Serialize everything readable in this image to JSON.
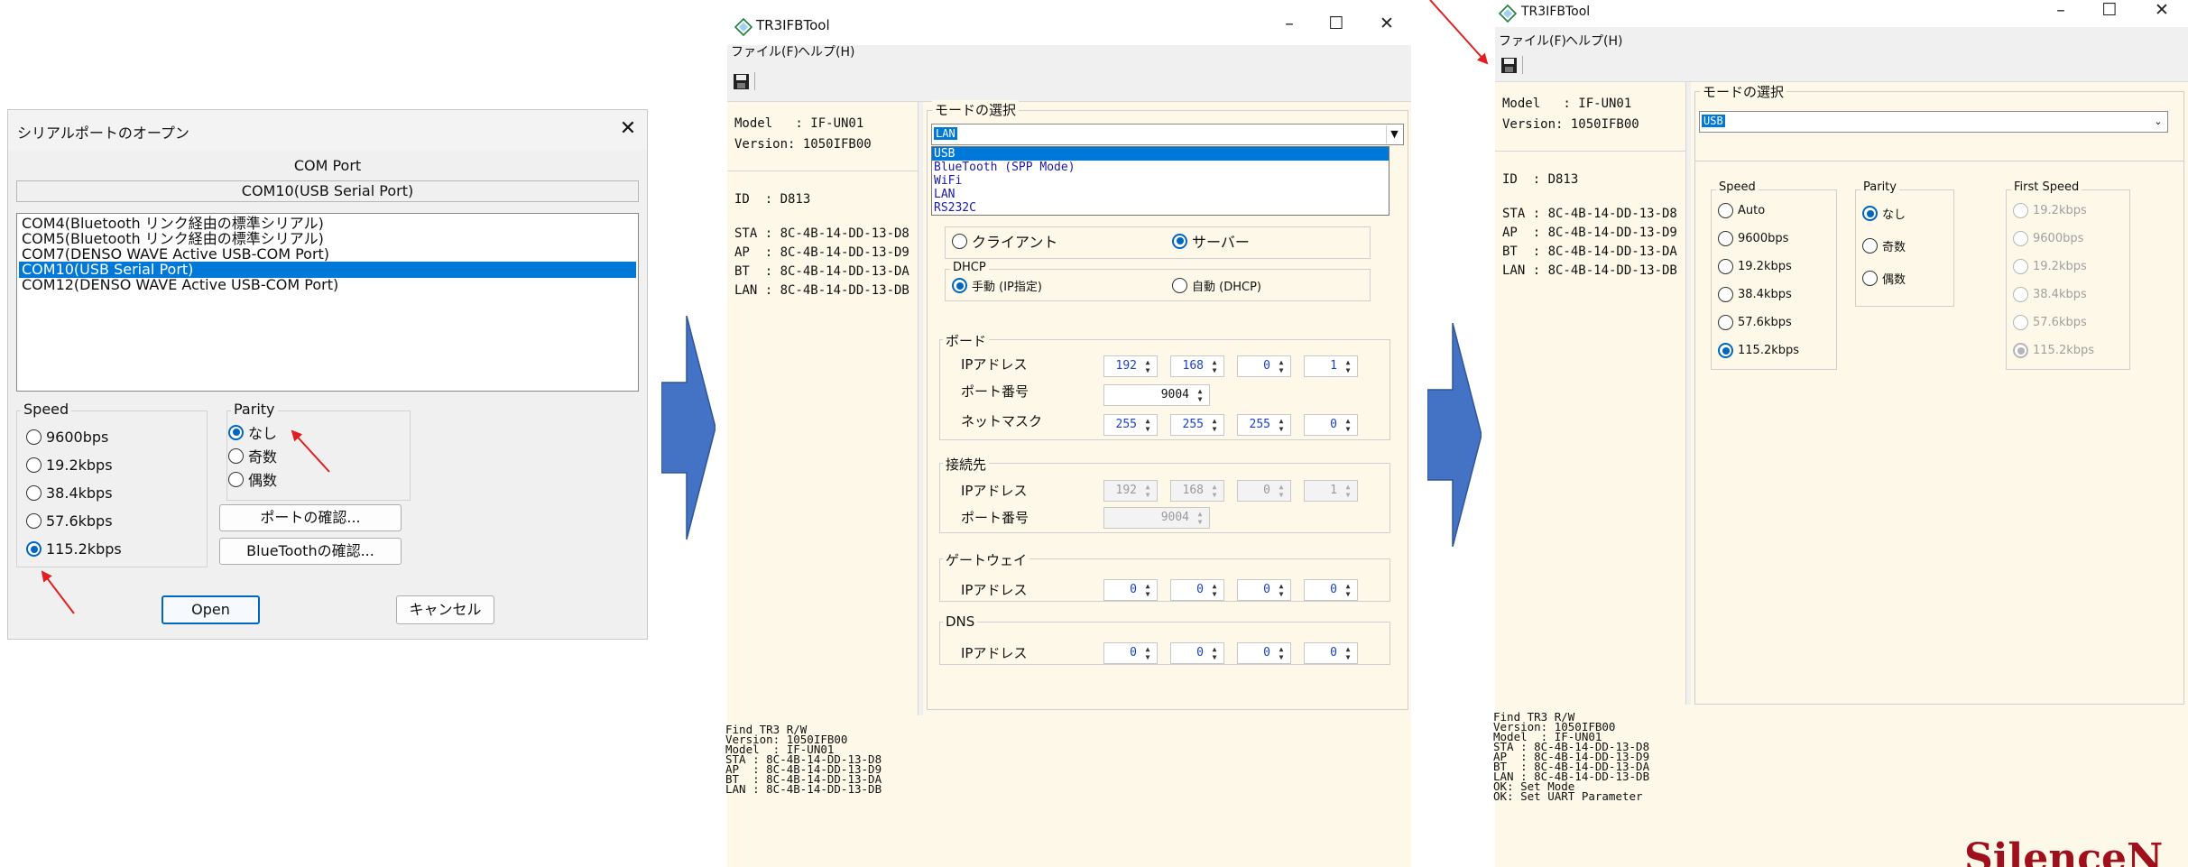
{
  "serial_dialog": {
    "title": "シリアルポートのオープン",
    "com_port_label": "COM Port",
    "com_port_value": "COM10(USB Serial Port)",
    "ports": [
      "COM4(Bluetooth リンク経由の標準シリアル)",
      "COM5(Bluetooth リンク経由の標準シリアル)",
      "COM7(DENSO WAVE Active USB-COM Port)",
      "COM10(USB Serial Port)",
      "COM12(DENSO WAVE Active USB-COM Port)"
    ],
    "selected_port_index": 3,
    "speed_label": "Speed",
    "speeds": [
      "9600bps",
      "19.2kbps",
      "38.4kbps",
      "57.6kbps",
      "115.2kbps"
    ],
    "selected_speed_index": 4,
    "parity_label": "Parity",
    "parities": [
      "なし",
      "奇数",
      "偶数"
    ],
    "selected_parity_index": 0,
    "port_check_button": "ポートの確認...",
    "bluetooth_check_button": "BlueToothの確認...",
    "open_button": "Open",
    "cancel_button": "キャンセル"
  },
  "tool_left": {
    "title": "TR3IFBTool",
    "menu": {
      "file": "ファイル(F)",
      "help": "ヘルプ(H)"
    },
    "info": {
      "model": "Model   : IF-UN01",
      "version": "Version: 1050IFB00",
      "id": "ID  : D813",
      "sta": "STA : 8C-4B-14-DD-13-D8",
      "ap": "AP  : 8C-4B-14-DD-13-D9",
      "bt": "BT  : 8C-4B-14-DD-13-DA",
      "lan": "LAN : 8C-4B-14-DD-13-DB"
    },
    "mode_label": "モードの選択",
    "mode_value": "LAN",
    "mode_options": [
      "USB",
      "BlueTooth (SPP Mode)",
      "WiFi",
      "LAN",
      "RS232C"
    ],
    "mode_highlight_index": 0,
    "client_label": "クライアント",
    "server_label": "サーバー",
    "dhcp_label": "DHCP",
    "manual_label": "手動 (IP指定)",
    "auto_label": "自動 (DHCP)",
    "board_label": "ボード",
    "ip_label": "IPアドレス",
    "board_ip": [
      "192",
      "168",
      "0",
      "1"
    ],
    "port_label": "ポート番号",
    "board_port": "9004",
    "netmask_label": "ネットマスク",
    "netmask": [
      "255",
      "255",
      "255",
      "0"
    ],
    "dest_label": "接続先",
    "dest_ip": [
      "192",
      "168",
      "0",
      "1"
    ],
    "dest_port": "9004",
    "gateway_label": "ゲートウェイ",
    "gateway_ip": [
      "0",
      "0",
      "0",
      "0"
    ],
    "dns_label": "DNS",
    "dns_ip": [
      "0",
      "0",
      "0",
      "0"
    ],
    "log": [
      "Find TR3 R/W",
      "Version: 1050IFB00",
      "Model  : IF-UN01",
      "STA : 8C-4B-14-DD-13-D8",
      "AP  : 8C-4B-14-DD-13-D9",
      "BT  : 8C-4B-14-DD-13-DA",
      "LAN : 8C-4B-14-DD-13-DB"
    ]
  },
  "tool_right": {
    "title": "TR3IFBTool",
    "menu": {
      "file": "ファイル(F)",
      "help": "ヘルプ(H)"
    },
    "info": {
      "model": "Model   : IF-UN01",
      "version": "Version: 1050IFB00",
      "id": "ID  : D813",
      "sta": "STA : 8C-4B-14-DD-13-D8",
      "ap": "AP  : 8C-4B-14-DD-13-D9",
      "bt": "BT  : 8C-4B-14-DD-13-DA",
      "lan": "LAN : 8C-4B-14-DD-13-DB"
    },
    "mode_label": "モードの選択",
    "mode_value": "USB",
    "speed_label": "Speed",
    "speeds": [
      "Auto",
      "9600bps",
      "19.2kbps",
      "38.4kbps",
      "57.6kbps",
      "115.2kbps"
    ],
    "selected_speed_index": 5,
    "parity_label": "Parity",
    "parities": [
      "なし",
      "奇数",
      "偶数"
    ],
    "selected_parity_index": 0,
    "first_speed_label": "First Speed",
    "first_speeds": [
      "19.2kbps",
      "9600bps",
      "19.2kbps",
      "38.4kbps",
      "57.6kbps",
      "115.2kbps"
    ],
    "selected_first_speed_index": 5,
    "log": [
      "Find TR3 R/W",
      "Version: 1050IFB00",
      "Model  : IF-UN01",
      "STA : 8C-4B-14-DD-13-D8",
      "AP  : 8C-4B-14-DD-13-D9",
      "BT  : 8C-4B-14-DD-13-DA",
      "LAN : 8C-4B-14-DD-13-DB",
      "OK: Set Mode",
      "OK: Set UART Parameter"
    ]
  },
  "watermark_text": "SilenceN",
  "colors": {
    "accent": "#0078d7",
    "flow_arrow": "#4472c4",
    "annotation_arrow": "#e02020",
    "panel_cream": "#fdf8e8",
    "watermark": "#a0101c"
  }
}
